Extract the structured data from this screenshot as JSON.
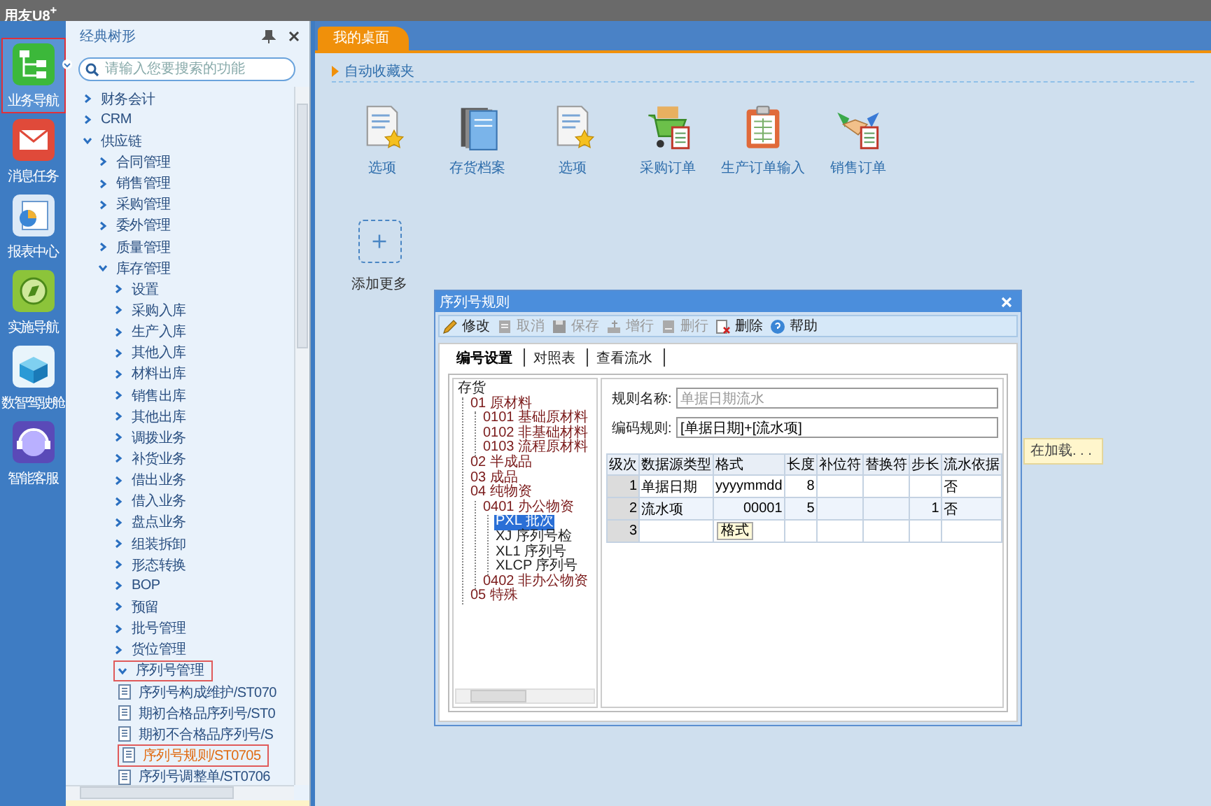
{
  "app": {
    "title": "用友U8$^{+}$"
  },
  "rail": [
    {
      "label": "业务导航",
      "kind": "org",
      "selected": true
    },
    {
      "label": "消息任务",
      "kind": "mail",
      "selected": false
    },
    {
      "label": "报表中心",
      "kind": "report",
      "selected": false
    },
    {
      "label": "实施导航",
      "kind": "compass",
      "selected": false
    },
    {
      "label": "数智驾驶舱",
      "kind": "cube",
      "selected": false
    },
    {
      "label": "智能客服",
      "kind": "headset",
      "selected": false
    }
  ],
  "nav": {
    "title": "经典树形",
    "search_placeholder": "请输入您要搜索的功能",
    "items": [
      {
        "label": "财务会计",
        "expanded": false,
        "outlined": false
      },
      {
        "label": "CRM",
        "expanded": false,
        "outlined": false
      },
      {
        "label": "供应链",
        "expanded": true,
        "outlined": false,
        "children": [
          {
            "label": "合同管理",
            "expanded": false,
            "outlined": false
          },
          {
            "label": "销售管理",
            "expanded": false,
            "outlined": false
          },
          {
            "label": "采购管理",
            "expanded": false,
            "outlined": false
          },
          {
            "label": "委外管理",
            "expanded": false,
            "outlined": false
          },
          {
            "label": "质量管理",
            "expanded": false,
            "outlined": false
          },
          {
            "label": "库存管理",
            "expanded": true,
            "outlined": false,
            "children": [
              {
                "label": "设置",
                "expanded": false,
                "outlined": false
              },
              {
                "label": "采购入库",
                "expanded": false,
                "outlined": false
              },
              {
                "label": "生产入库",
                "expanded": false,
                "outlined": false
              },
              {
                "label": "其他入库",
                "expanded": false,
                "outlined": false
              },
              {
                "label": "材料出库",
                "expanded": false,
                "outlined": false
              },
              {
                "label": "销售出库",
                "expanded": false,
                "outlined": false
              },
              {
                "label": "其他出库",
                "expanded": false,
                "outlined": false
              },
              {
                "label": "调拨业务",
                "expanded": false,
                "outlined": false
              },
              {
                "label": "补货业务",
                "expanded": false,
                "outlined": false
              },
              {
                "label": "借出业务",
                "expanded": false,
                "outlined": false
              },
              {
                "label": "借入业务",
                "expanded": false,
                "outlined": false
              },
              {
                "label": "盘点业务",
                "expanded": false,
                "outlined": false
              },
              {
                "label": "组装拆卸",
                "expanded": false,
                "outlined": false
              },
              {
                "label": "形态转换",
                "expanded": false,
                "outlined": false
              },
              {
                "label": "BOP",
                "expanded": false,
                "outlined": false
              },
              {
                "label": "预留",
                "expanded": false,
                "outlined": false
              },
              {
                "label": "批号管理",
                "expanded": false,
                "outlined": false
              },
              {
                "label": "货位管理",
                "expanded": false,
                "outlined": false
              },
              {
                "label": "序列号管理",
                "expanded": true,
                "outlined": true,
                "children": [
                  {
                    "label": "序列号构成维护/ST070",
                    "kind": "document",
                    "selected": false,
                    "outlined": false
                  },
                  {
                    "label": "期初合格品序列号/ST0",
                    "kind": "document",
                    "selected": false,
                    "outlined": false
                  },
                  {
                    "label": "期初不合格品序列号/S",
                    "kind": "document",
                    "selected": false,
                    "outlined": false
                  },
                  {
                    "label": "序列号规则/ST0705",
                    "kind": "document",
                    "selected": true,
                    "outlined": true
                  },
                  {
                    "label": "序列号调整单/ST0706",
                    "kind": "document",
                    "selected": false,
                    "outlined": false
                  }
                ]
              }
            ]
          }
        ]
      }
    ]
  },
  "desktop": {
    "tab": "我的桌面",
    "section": "自动收藏夹",
    "shortcuts": [
      {
        "label": "选项",
        "kind": "options"
      },
      {
        "label": "存货档案",
        "kind": "archive"
      },
      {
        "label": "选项",
        "kind": "options"
      },
      {
        "label": "采购订单",
        "kind": "purchase"
      },
      {
        "label": "生产订单输入",
        "kind": "production"
      },
      {
        "label": "销售订单",
        "kind": "sales"
      }
    ],
    "add_label": "添加更多",
    "loading": "在加载. . ."
  },
  "dialog": {
    "title": "序列号规则",
    "toolbar": [
      {
        "label": "修改",
        "kind": "edit",
        "disabled": false
      },
      {
        "label": "取消",
        "kind": "cancel",
        "disabled": true
      },
      {
        "label": "保存",
        "kind": "save",
        "disabled": true
      },
      {
        "label": "增行",
        "kind": "addrow",
        "disabled": true
      },
      {
        "label": "删行",
        "kind": "delrow",
        "disabled": true
      },
      {
        "label": "删除",
        "kind": "delete",
        "disabled": false
      },
      {
        "label": "帮助",
        "kind": "help",
        "disabled": false
      }
    ],
    "tabs": [
      {
        "label": "编号设置",
        "selected": true
      },
      {
        "label": "对照表",
        "selected": false
      },
      {
        "label": "查看流水",
        "selected": false
      }
    ],
    "tree": [
      {
        "label": "存货",
        "selected": false,
        "children": [
          {
            "label": "01 原材料",
            "selected": false,
            "children": [
              {
                "label": "0101 基础原材料",
                "selected": false
              },
              {
                "label": "0102 非基础材料",
                "selected": false
              },
              {
                "label": "0103 流程原材料",
                "selected": false
              }
            ]
          },
          {
            "label": "02 半成品",
            "selected": false
          },
          {
            "label": "03 成品",
            "selected": false
          },
          {
            "label": "04 纯物资",
            "selected": false,
            "children": [
              {
                "label": "0401 办公物资",
                "selected": false,
                "children": [
                  {
                    "label": "PXL 批次",
                    "selected": true
                  },
                  {
                    "label": "XJ 序列号检",
                    "selected": false
                  },
                  {
                    "label": "XL1 序列号",
                    "selected": false
                  },
                  {
                    "label": "XLCP 序列号",
                    "selected": false
                  }
                ]
              },
              {
                "label": "0402 非办公物资",
                "selected": false
              }
            ]
          },
          {
            "label": "05 特殊",
            "selected": false
          }
        ]
      }
    ],
    "fields": [
      {
        "label": "规则名称:",
        "value": "单据日期流水",
        "disabled": true
      },
      {
        "label": "编码规则:",
        "value": "[单据日期]+[流水项]",
        "disabled": false
      }
    ],
    "grid": {
      "columns": [
        "级次",
        "数据源类型",
        "格式",
        "长度",
        "补位符",
        "替换符",
        "步长",
        "流水依据"
      ],
      "rows": [
        [
          "1",
          "单据日期",
          "yyyymmdd",
          "8",
          null,
          null,
          null,
          "否"
        ],
        [
          "2",
          "流水项",
          "00001",
          "5",
          null,
          null,
          "1",
          "否"
        ],
        [
          "3",
          null,
          null,
          null,
          null,
          null,
          null,
          null
        ]
      ]
    },
    "tooltip": "格式"
  }
}
